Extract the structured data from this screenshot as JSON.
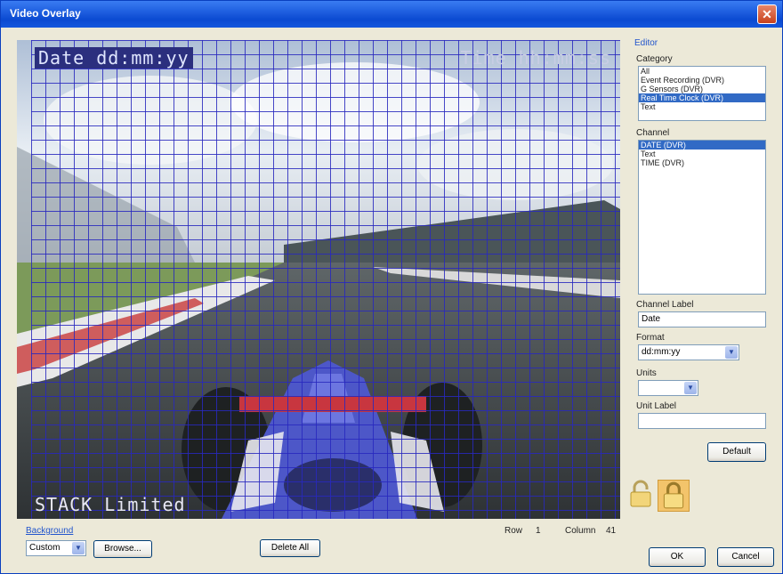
{
  "window": {
    "title": "Video Overlay",
    "close_glyph": "✕"
  },
  "video": {
    "overlay_date": "Date dd:mm:yy",
    "overlay_time": "Time hh:mm:ss",
    "overlay_label": "STACK Limited"
  },
  "bottom": {
    "background_label": "Background",
    "background_value": "Custom",
    "browse_label": "Browse...",
    "delete_all_label": "Delete All",
    "row_label": "Row",
    "row_value": "1",
    "column_label": "Column",
    "column_value": "41",
    "ok_label": "OK",
    "cancel_label": "Cancel"
  },
  "editor": {
    "title": "Editor",
    "category_label": "Category",
    "category_items": [
      {
        "label": "All",
        "selected": false
      },
      {
        "label": "Event Recording (DVR)",
        "selected": false
      },
      {
        "label": "G Sensors (DVR)",
        "selected": false
      },
      {
        "label": "Real Time Clock (DVR)",
        "selected": true
      },
      {
        "label": "Text",
        "selected": false
      }
    ],
    "channel_label": "Channel",
    "channel_items": [
      {
        "label": "DATE (DVR)",
        "selected": true
      },
      {
        "label": "Text",
        "selected": false
      },
      {
        "label": "TIME (DVR)",
        "selected": false
      }
    ],
    "channel_label_label": "Channel Label",
    "channel_label_value": "Date",
    "format_label": "Format",
    "format_value": "dd:mm:yy",
    "units_label": "Units",
    "units_value": "",
    "unit_label_label": "Unit Label",
    "unit_label_value": "",
    "default_label": "Default"
  },
  "icons": {
    "dropdown_arrow": "▼",
    "lock_open": "lock-open-icon",
    "lock_closed": "lock-closed-icon"
  },
  "colors": {
    "grid": "#2828be",
    "selection": "#316ac5",
    "title_bar": "#1f5fe0"
  }
}
